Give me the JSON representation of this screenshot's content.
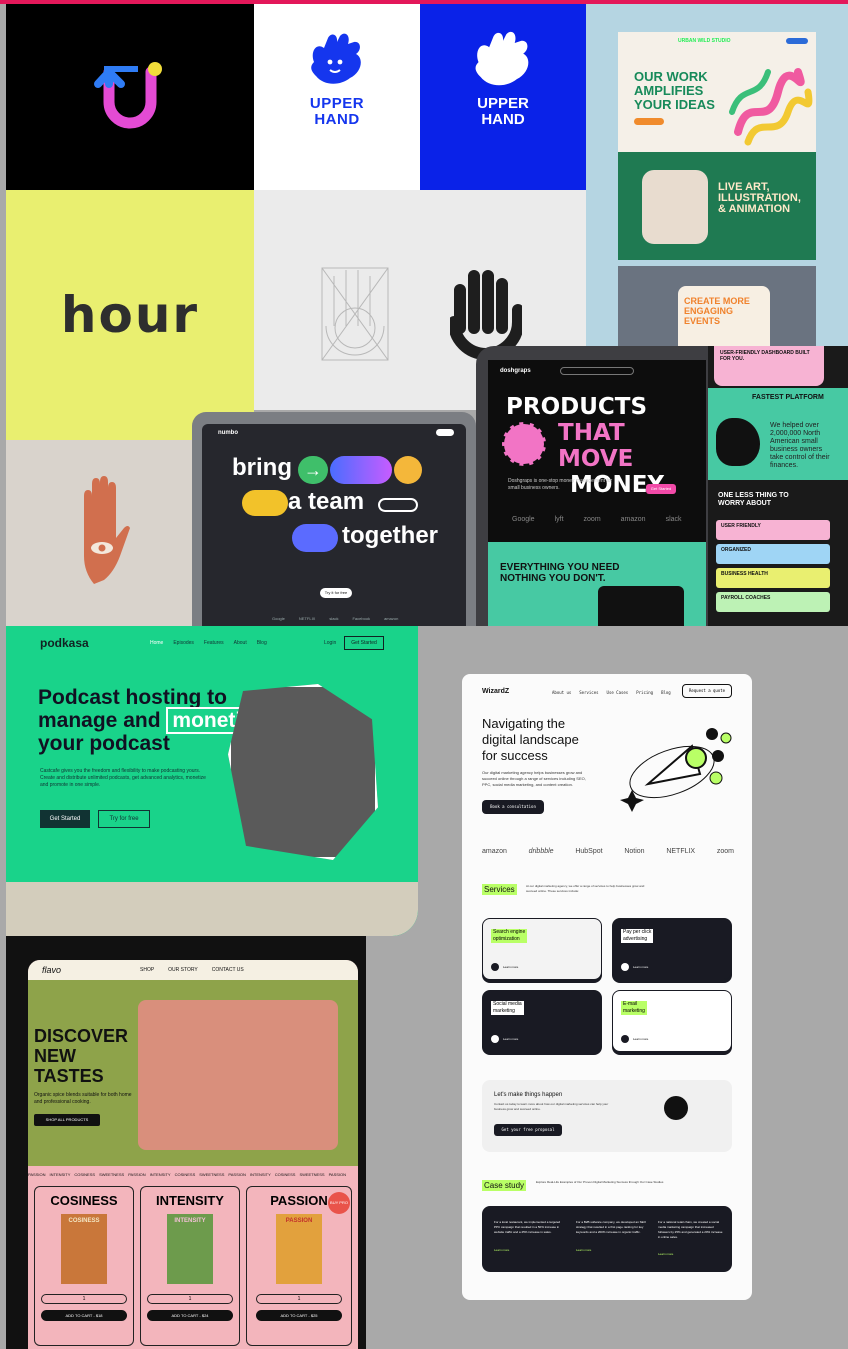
{
  "colors": {
    "pink": "#e3185a",
    "mint": "#19d38a",
    "yellow": "#e9ef70",
    "blue": "#0a22e8",
    "navy": "#0d1a3a",
    "lime": "#c6f36b"
  },
  "tiles": {
    "upperhand_1": {
      "line1": "UPPER",
      "line2": "HAND"
    },
    "upperhand_2": {
      "line1": "UPPER",
      "line2": "HAND"
    },
    "hour": {
      "word": "hour"
    },
    "studio": {
      "nav": "URBAN WILD STUDIO",
      "headline": [
        "OUR WORK",
        "AMPLIFIES",
        "YOUR IDEAS"
      ],
      "sub": [
        "LIVE ART,",
        "ILLUSTRATION,",
        "& ANIMATION"
      ],
      "events": [
        "CREATE MORE",
        "ENGAGING",
        "EVENTS"
      ]
    }
  },
  "numbo": {
    "logo": "numbo",
    "words": [
      "bring",
      "a team",
      "together"
    ],
    "cta": "Try it for free",
    "logos": [
      "Google",
      "NETFLIX",
      "slack",
      "Facebook",
      "amazon"
    ]
  },
  "dosh": {
    "logo": "doshgraps",
    "headline": [
      "PRODUCTS",
      "THAT MOVE",
      "MONEY"
    ],
    "desc": "Doshgraps is one-stop money management for small business owners.",
    "cta": "Get Started",
    "logos": [
      "Google",
      "lyft",
      "zoom",
      "amazon",
      "slack"
    ],
    "bottom": [
      "EVERYTHING YOU NEED",
      "NOTHING YOU DON'T."
    ],
    "side_top": "USER-FRIENDLY DASHBOARD BUILT FOR YOU.",
    "side_fast": "FASTEST PLATFORM",
    "side_helped": [
      "We helped over",
      "2,000,000 North",
      "American small",
      "business owners",
      "take control of their",
      "finances."
    ],
    "side_one_less": [
      "ONE LESS THING TO",
      "WORRY ABOUT"
    ],
    "side_items": [
      "USER FRIENDLY",
      "ORGANIZED",
      "BUSINESS HEALTH",
      "PAYROLL COACHES"
    ]
  },
  "podkasa": {
    "logo": "podkasa",
    "nav": [
      "Home",
      "Episodes",
      "Features",
      "About",
      "Blog"
    ],
    "login": "Login",
    "get_started_nav": "Get Started",
    "headline": [
      "Podcast hosting to",
      "manage and",
      "monetize",
      "your podcast"
    ],
    "desc": "Castcafe gives you the freedom and flexibility to make podcasting yours. Create and distribute unlimited podcasts, get advanced analytics, monetize and promote in one simple.",
    "cta_primary": "Get Started",
    "cta_secondary": "Try for free"
  },
  "flavo": {
    "logo": "flavo",
    "nav": [
      "SHOP",
      "OUR STORY",
      "CONTACT US"
    ],
    "headline": [
      "DISCOVER",
      "NEW",
      "TASTES"
    ],
    "desc": "Organic spice blends suitable for both home and professional cooking.",
    "shop_all": "SHOP ALL PRODUCTS",
    "ticker": [
      "PASSION",
      "INTENSITY",
      "COSINESS",
      "SWEETNESS",
      "PASSION",
      "INTENSITY",
      "COSINESS",
      "SWEETNESS",
      "PASSION",
      "INTENSITY",
      "COSINESS",
      "SWEETNESS",
      "PASSION"
    ],
    "badge": "BUY PRO",
    "products": [
      {
        "name": "COSINESS",
        "label": "COSINESS",
        "price": "ADD TO CART - $18",
        "qty": "1"
      },
      {
        "name": "INTENSITY",
        "label": "INTENSITY",
        "price": "ADD TO CART - $24",
        "qty": "1"
      },
      {
        "name": "PASSION",
        "label": "PASSION",
        "price": "ADD TO CART - $25",
        "qty": "1"
      }
    ]
  },
  "wizard": {
    "logo": "WizardZ",
    "nav": [
      "About us",
      "Services",
      "Use Cases",
      "Pricing",
      "Blog"
    ],
    "cta_nav": "Request a quote",
    "headline": [
      "Navigating the",
      "digital landscape",
      "for success"
    ],
    "desc": "Our digital marketing agency helps businesses grow and succeed online through a range of services including SEO, PPC, social media marketing, and content creation.",
    "cta": "Book a consultation",
    "logos": [
      "amazon",
      "dribbble",
      "HubSpot",
      "Notion",
      "NETFLIX",
      "zoom"
    ],
    "services_title": "Services",
    "services_desc": "At our digital marketing agency, we offer a range of services to help businesses grow and succeed online. These services include:",
    "services": [
      {
        "title": [
          "Search engine",
          "optimization"
        ],
        "link": "Learn more",
        "theme": "light"
      },
      {
        "title": [
          "Pay per click",
          "advertising"
        ],
        "link": "Learn more",
        "theme": "dark"
      },
      {
        "title": [
          "Social media",
          "marketing"
        ],
        "link": "Learn more",
        "theme": "dark"
      },
      {
        "title": [
          "E-mail",
          "marketing"
        ],
        "link": "Learn more",
        "theme": "light"
      }
    ],
    "lets_title": "Let's make things happen",
    "lets_desc": "Contact us today to learn more about how our digital marketing services can help your business grow and succeed online.",
    "lets_cta": "Get your free proposal",
    "case_title": "Case study",
    "case_desc": "Explore Real-Life Examples of Our Proven Digital Marketing Success through Our Case Studies",
    "cases": [
      "For a local restaurant, we implemented a targeted PPC campaign that resulted in a 50% increase in website traffic and a 25% increase in sales.",
      "For a B2B software company, we developed an SEO strategy that resulted in a first page ranking for key keywords and a 200% increase in organic traffic.",
      "For a national retail chain, we created a social media marketing campaign that increased followers by 25% and generated a 20% increase in online sales."
    ],
    "case_link": "Learn more"
  }
}
